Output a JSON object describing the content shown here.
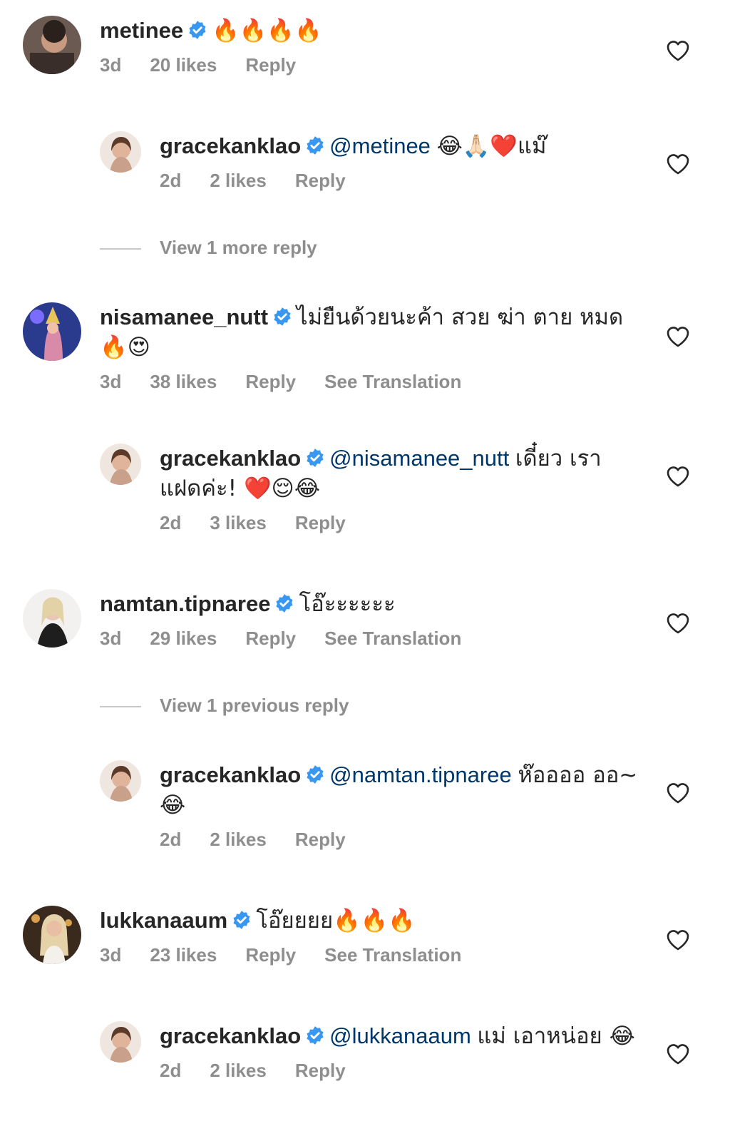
{
  "colors": {
    "text": "#262626",
    "meta": "#8e8e8e",
    "mention": "#00376b",
    "verified": "#3897f0",
    "divider": "#c7c7c7"
  },
  "comments": [
    {
      "username": "metinee",
      "text": "🔥🔥🔥🔥",
      "time": "3d",
      "likes": "20 likes",
      "reply": "Reply",
      "avatar_icon": "avatar-photo"
    },
    {
      "username": "gracekanklao",
      "mention": "@metinee",
      "text": "😂🙏🏻❤️แม๊",
      "time": "2d",
      "likes": "2 likes",
      "reply": "Reply"
    },
    {
      "view_replies": "View 1 more reply"
    },
    {
      "username": "nisamanee_nutt",
      "text": "ไม่ยืนด้วยนะค้า สวย ฆ่า ตาย หมด 🔥😍",
      "time": "3d",
      "likes": "38 likes",
      "reply": "Reply",
      "translate": "See Translation"
    },
    {
      "username": "gracekanklao",
      "mention": "@nisamanee_nutt",
      "text": "เดี๋ยว เรา แฝดค่ะ! ❤️😌😂",
      "time": "2d",
      "likes": "3 likes",
      "reply": "Reply"
    },
    {
      "username": "namtan.tipnaree",
      "text": "โอ๊ะะะะะะ",
      "time": "3d",
      "likes": "29 likes",
      "reply": "Reply",
      "translate": "See Translation"
    },
    {
      "view_replies": "View 1 previous reply"
    },
    {
      "username": "gracekanklao",
      "mention": "@namtan.tipnaree",
      "text": "ห๊ออออ ออ~😂",
      "time": "2d",
      "likes": "2 likes",
      "reply": "Reply"
    },
    {
      "username": "lukkanaaum",
      "text": "โอ๊ยยยย🔥🔥🔥",
      "time": "3d",
      "likes": "23 likes",
      "reply": "Reply",
      "translate": "See Translation"
    },
    {
      "username": "gracekanklao",
      "mention": "@lukkanaaum",
      "text": "แม่ เอาหน่อย 😂",
      "time": "2d",
      "likes": "2 likes",
      "reply": "Reply"
    }
  ]
}
